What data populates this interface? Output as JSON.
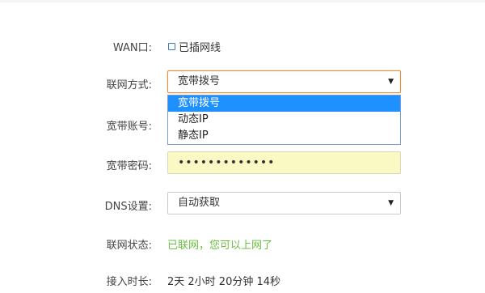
{
  "wan": {
    "label": "WAN口:",
    "status": "已插网线",
    "icon": "checkbox-square-icon"
  },
  "connection_type": {
    "label": "联网方式:",
    "value": "宽带拨号",
    "options": [
      "宽带拨号",
      "动态IP",
      "静态IP"
    ],
    "selected_index": 0
  },
  "account": {
    "label": "宽带账号:"
  },
  "password": {
    "label": "宽带密码:",
    "masked_value": "•••••••••••••"
  },
  "dns": {
    "label": "DNS设置:",
    "value": "自动获取"
  },
  "status": {
    "label": "联网状态:",
    "value": "已联网，您可以上网了"
  },
  "uptime": {
    "label": "接入时长:",
    "value": "2天 2小时 20分钟 14秒"
  },
  "colors": {
    "status_green": "#6abf40",
    "focus_orange": "#f08a2c",
    "selection_blue": "#1e90ff"
  }
}
